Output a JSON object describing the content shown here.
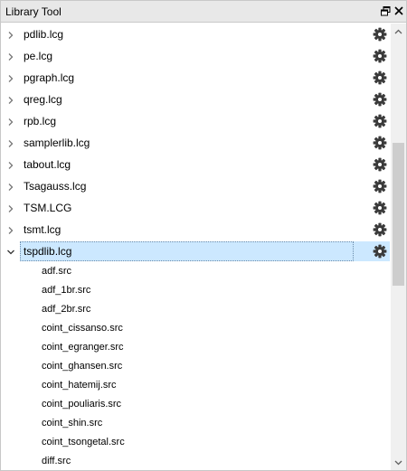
{
  "window": {
    "title": "Library Tool"
  },
  "libraries": [
    {
      "label": "pdlib.lcg",
      "expanded": false,
      "selected": false
    },
    {
      "label": "pe.lcg",
      "expanded": false,
      "selected": false
    },
    {
      "label": "pgraph.lcg",
      "expanded": false,
      "selected": false
    },
    {
      "label": "qreg.lcg",
      "expanded": false,
      "selected": false
    },
    {
      "label": "rpb.lcg",
      "expanded": false,
      "selected": false
    },
    {
      "label": "samplerlib.lcg",
      "expanded": false,
      "selected": false
    },
    {
      "label": "tabout.lcg",
      "expanded": false,
      "selected": false
    },
    {
      "label": "Tsagauss.lcg",
      "expanded": false,
      "selected": false
    },
    {
      "label": "TSM.LCG",
      "expanded": false,
      "selected": false
    },
    {
      "label": "tsmt.lcg",
      "expanded": false,
      "selected": false
    },
    {
      "label": "tspdlib.lcg",
      "expanded": true,
      "selected": true
    }
  ],
  "expanded_children": [
    "adf.src",
    "adf_1br.src",
    "adf_2br.src",
    "coint_cissanso.src",
    "coint_egranger.src",
    "coint_ghansen.src",
    "coint_hatemij.src",
    "coint_pouliaris.src",
    "coint_shin.src",
    "coint_tsongetal.src",
    "diff.src"
  ],
  "icons": {
    "expand": "chevron-right-icon",
    "collapse": "chevron-down-icon",
    "library_action": "gear-icon",
    "float": "float-window-icon",
    "close": "close-icon"
  },
  "colors": {
    "selection": "#cce8ff",
    "titlebar": "#e8e8e8",
    "scroll_thumb": "#cdcdcd"
  }
}
